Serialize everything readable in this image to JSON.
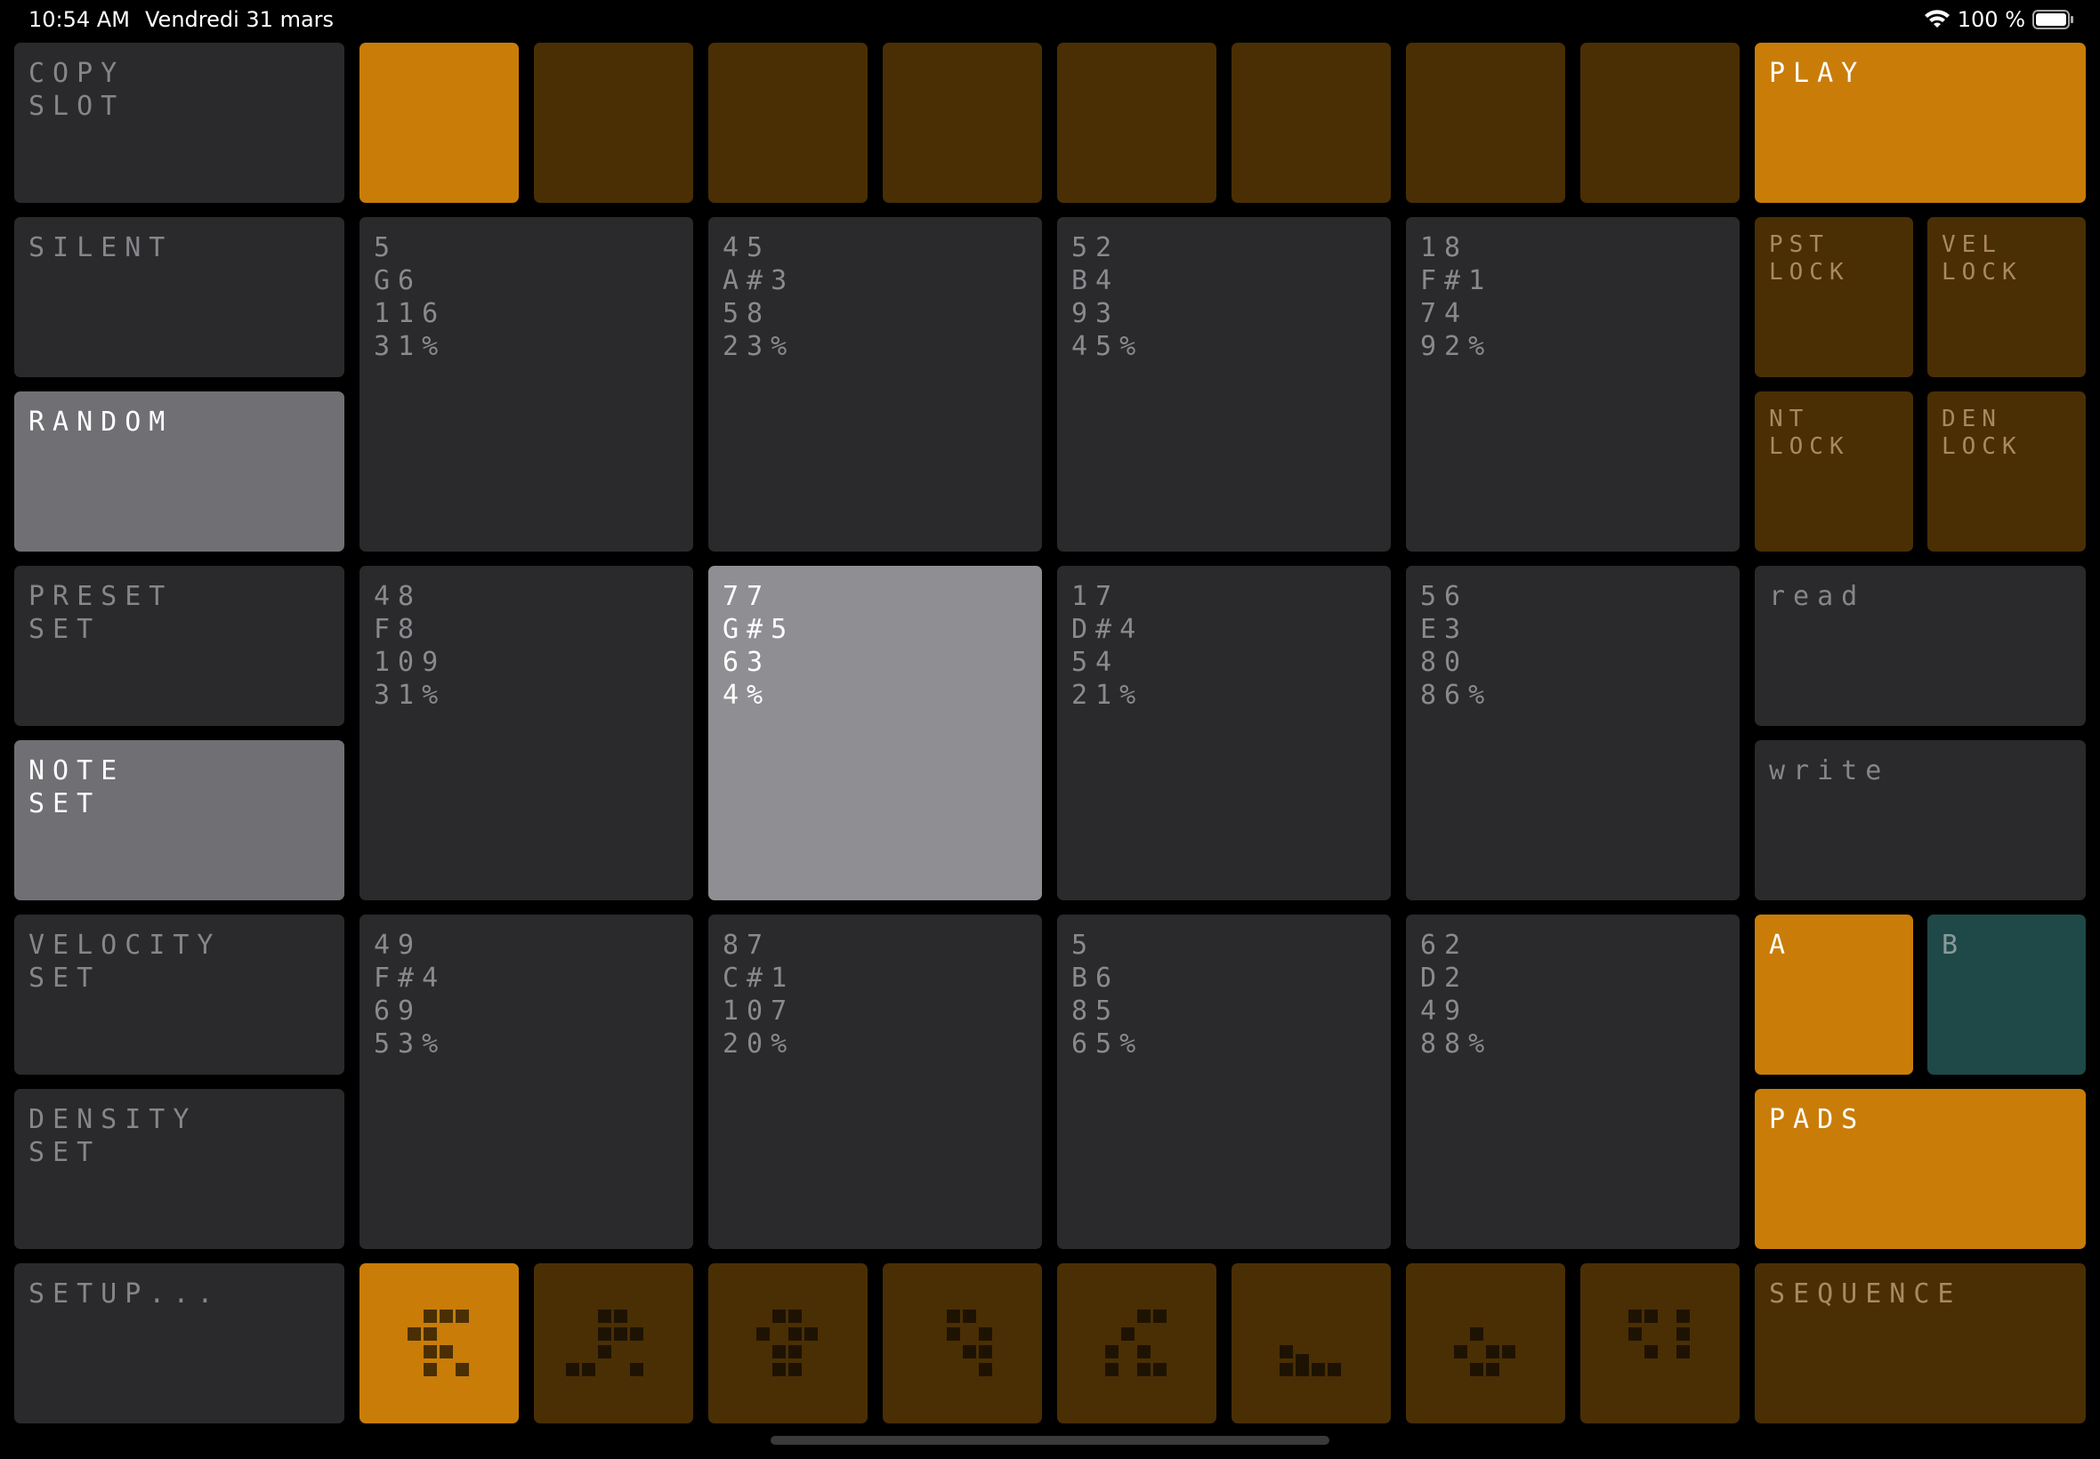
{
  "status": {
    "time": "10:54 AM",
    "date": "Vendredi 31 mars",
    "battery": "100 %"
  },
  "left": {
    "copy_slot": "COPY\nSLOT",
    "silent": "SILENT",
    "random": "RANDOM",
    "preset_set": "PRESET\nSET",
    "note_set": "NOTE\nSET",
    "velocity_set": "VELOCITY\nSET",
    "density_set": "DENSITY\nSET",
    "setup": "SETUP..."
  },
  "right": {
    "play": "PLAY",
    "pst_lock": "PST\nLOCK",
    "vel_lock": "VEL\nLOCK",
    "nt_lock": "NT\nLOCK",
    "den_lock": "DEN\nLOCK",
    "read": "read",
    "write": "write",
    "a": "A",
    "b": "B",
    "pads": "PADS",
    "sequence": "SEQUENCE"
  },
  "slots": {
    "active_index": 0,
    "count": 8
  },
  "pads": [
    {
      "n": "5",
      "note": "G6",
      "vel": "116",
      "den": "31%"
    },
    {
      "n": "45",
      "note": "A#3",
      "vel": "58",
      "den": "23%"
    },
    {
      "n": "52",
      "note": "B4",
      "vel": "93",
      "den": "45%"
    },
    {
      "n": "18",
      "note": "F#1",
      "vel": "74",
      "den": "92%"
    },
    {
      "n": "48",
      "note": "F8",
      "vel": "109",
      "den": "31%"
    },
    {
      "n": "77",
      "note": "G#5",
      "vel": "63",
      "den": "4%"
    },
    {
      "n": "17",
      "note": "D#4",
      "vel": "54",
      "den": "21%"
    },
    {
      "n": "56",
      "note": "E3",
      "vel": "80",
      "den": "86%"
    },
    {
      "n": "49",
      "note": "F#4",
      "vel": "69",
      "den": "53%"
    },
    {
      "n": "87",
      "note": "C#1",
      "vel": "107",
      "den": "20%"
    },
    {
      "n": "5",
      "note": "B6",
      "vel": "85",
      "den": "65%"
    },
    {
      "n": "62",
      "note": "D2",
      "vel": "49",
      "den": "88%"
    }
  ],
  "selected_pad": 5,
  "sequences": {
    "active_index": 0,
    "icons": [
      "pattern-1-icon",
      "pattern-2-icon",
      "pattern-3-icon",
      "pattern-4-icon",
      "pattern-5-icon",
      "pattern-6-icon",
      "pattern-7-icon",
      "pattern-8-icon"
    ]
  },
  "colors": {
    "orange": "#c97d08",
    "dark_orange": "#4a2f04",
    "dark_gray": "#2a2a2c",
    "light_gray": "#707074",
    "highlight_gray": "#8f8f93",
    "teal": "#1f4848"
  }
}
